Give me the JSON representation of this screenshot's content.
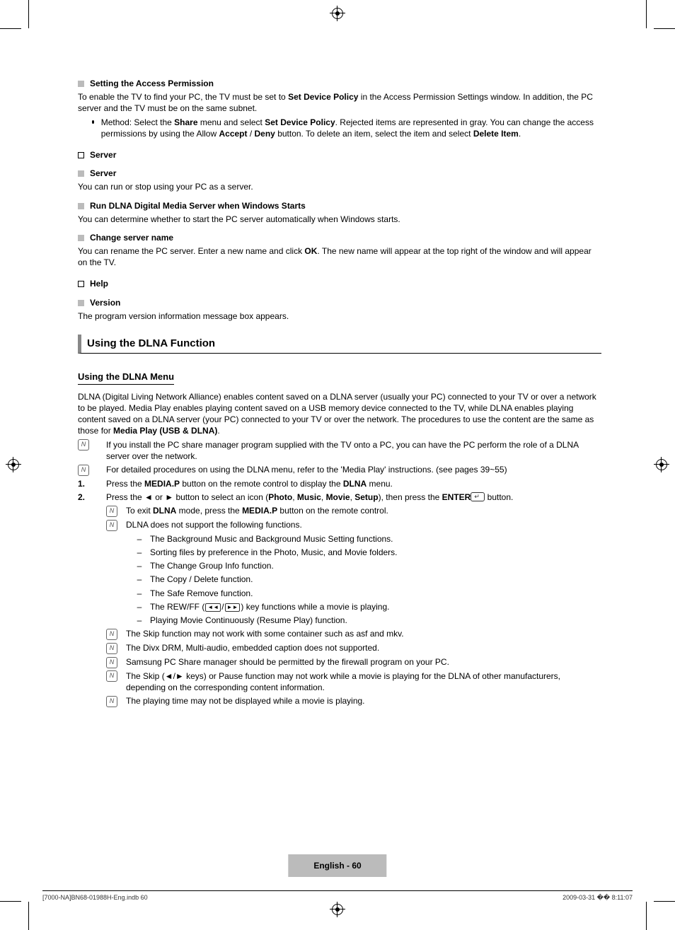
{
  "s_access": {
    "head": "Setting the Access Permission",
    "p1a": "To enable the TV to find your PC, the TV must be set to ",
    "p1b": "Set Device Policy",
    "p1c": " in the Access Permission Settings window. In addition, the PC server and the TV must be on the same subnet.",
    "m_a": "Method: Select the ",
    "m_b": "Share",
    "m_c": " menu and select ",
    "m_d": "Set Device Policy",
    "m_e": ". Rejected items are represented in gray. You can change the access permissions by using the Allow ",
    "m_f": "Accept",
    "m_g": " / ",
    "m_h": "Deny",
    "m_i": " button. To delete an item, select the item and select ",
    "m_j": "Delete Item",
    "m_k": "."
  },
  "server": {
    "head": "Server",
    "s1": "Server",
    "s1t": "You can run or stop using your PC as a server.",
    "s2": "Run DLNA Digital Media Server when Windows Starts",
    "s2t": "You can determine whether to start the PC server automatically when Windows starts.",
    "s3": "Change server name",
    "s3t_a": "You can rename the PC server. Enter a new name and click ",
    "s3t_b": "OK",
    "s3t_c": ". The new name will appear at the top right of the window and will appear on the TV."
  },
  "help": {
    "head": "Help",
    "v": "Version",
    "vt": "The program version information message box appears."
  },
  "dlna": {
    "title": "Using the DLNA Function",
    "menu_head": "Using the DLNA Menu",
    "intro_a": "DLNA (Digital Living Network Alliance) enables content saved on a DLNA server (usually your PC) connected to your TV or over a network to be played. Media Play enables playing content saved on a USB memory device connected to the TV, while DLNA enables playing content saved on a DLNA server (your PC) connected to your TV or over the network. The procedures to use the content are the same as those for ",
    "intro_b": "Media Play (USB & DLNA)",
    "intro_c": ".",
    "n1": "If you install the PC share manager program supplied with the TV onto a PC, you can have the PC perform the role of a DLNA server over the network.",
    "n2": "For detailed procedures on using the DLNA menu, refer to the 'Media Play' instructions. (see pages 39~55)",
    "step1_a": "Press the ",
    "step1_b": "MEDIA.P",
    "step1_c": " button on the remote control to display the ",
    "step1_d": "DLNA",
    "step1_e": " menu.",
    "step2_a": "Press the ◄ or ► button to select an icon (",
    "step2_b": "Photo",
    "step2_c": ", ",
    "step2_d": "Music",
    "step2_e": ", ",
    "step2_f": "Movie",
    "step2_g": ", ",
    "step2_h": "Setup",
    "step2_i": "), then press the ",
    "step2_j": "ENTER",
    "step2_k": " button.",
    "s2n1_a": "To exit ",
    "s2n1_b": "DLNA",
    "s2n1_c": " mode, press the ",
    "s2n1_d": "MEDIA.P",
    "s2n1_e": " button on the remote control.",
    "s2n2": "DLNA does not support the following functions.",
    "d1": "The Background Music and Background Music Setting functions.",
    "d2": "Sorting files by preference in the Photo, Music, and Movie folders.",
    "d3": "The Change Group Info function.",
    "d4": "The Copy / Delete function.",
    "d5": "The Safe Remove function.",
    "d6_a": "The REW/FF (",
    "d6_b": ") key functions while a movie is playing.",
    "d7": "Playing Movie Continuously (Resume Play) function.",
    "s2n3": "The Skip function may not work with some container such as asf and mkv.",
    "s2n4": "The Divx DRM, Multi-audio, embedded caption does not supported.",
    "s2n5": "Samsung PC Share manager should be permitted by the firewall program on your PC.",
    "s2n6": "The Skip (◄/► keys) or Pause function may not work while a movie is playing for the DLNA of other manufacturers, depending on the corresponding content information.",
    "s2n7": "The playing time may not be displayed while a movie is playing."
  },
  "footer": {
    "page": "English - 60",
    "left": "[7000-NA]BN68-01988H-Eng.indb   60",
    "right": "2009-03-31   �� 8:11:07"
  }
}
